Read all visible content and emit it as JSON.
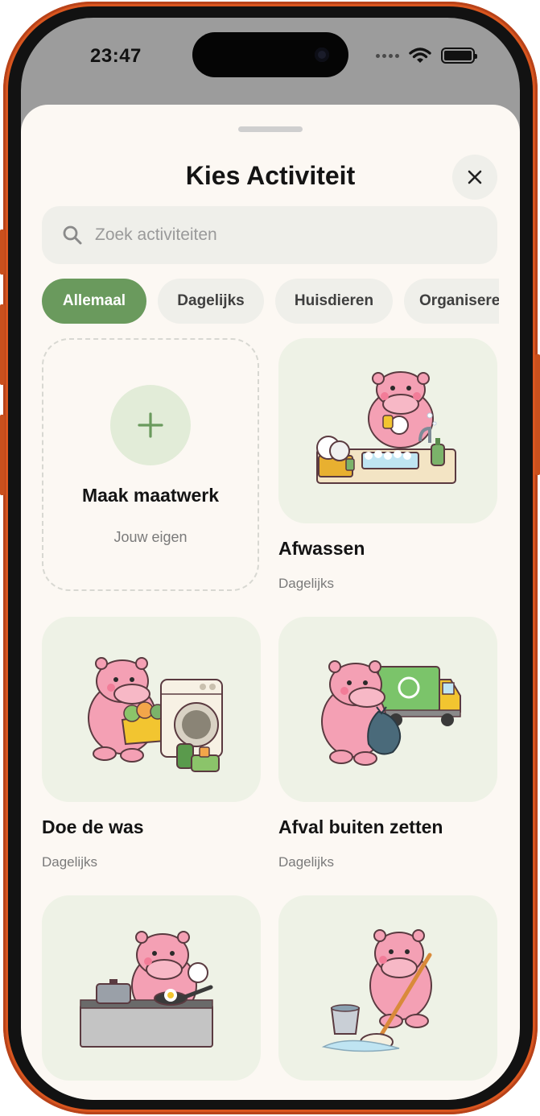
{
  "status_bar": {
    "time": "23:47"
  },
  "sheet": {
    "title": "Kies Activiteit",
    "close_icon": "close-icon"
  },
  "search": {
    "placeholder": "Zoek activiteiten",
    "value": "",
    "icon": "search-icon"
  },
  "filters": {
    "selected": "Allemaal",
    "chips": [
      {
        "label": "Allemaal"
      },
      {
        "label": "Dagelijks"
      },
      {
        "label": "Huisdieren"
      },
      {
        "label": "Organiseren"
      }
    ]
  },
  "custom_activity": {
    "title": "Maak maatwerk",
    "subtitle": "Jouw eigen",
    "icon": "plus-icon"
  },
  "activities": [
    {
      "title": "Afwassen",
      "category": "Dagelijks",
      "illustration": "hippo-washing-dishes"
    },
    {
      "title": "Doe de was",
      "category": "Dagelijks",
      "illustration": "hippo-doing-laundry"
    },
    {
      "title": "Afval buiten zetten",
      "category": "Dagelijks",
      "illustration": "hippo-taking-out-trash"
    },
    {
      "title": "",
      "category": "",
      "illustration": "hippo-cooking"
    },
    {
      "title": "",
      "category": "",
      "illustration": "hippo-mopping-floor"
    }
  ],
  "colors": {
    "frame": "#d9561f",
    "sheet_background": "#fcf8f3",
    "accent_green": "#6a9a5d",
    "chip_background": "#efefea",
    "card_background": "#eef2e6",
    "hippo_pink": "#f4a0b4"
  }
}
